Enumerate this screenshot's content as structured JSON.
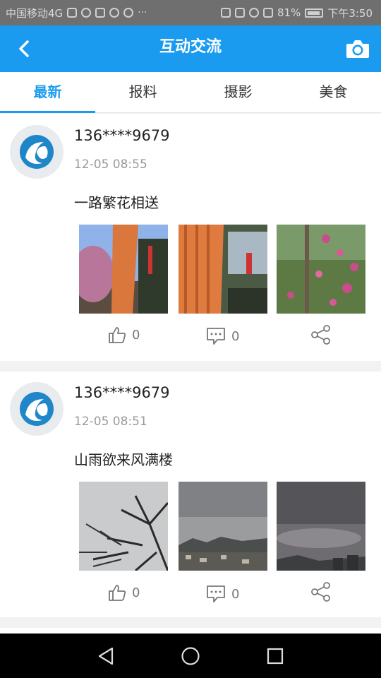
{
  "statusbar": {
    "carrier": "中国移动4G",
    "battery": "81%",
    "time": "下午3:50"
  },
  "header": {
    "title": "互动交流",
    "back_icon": "back-arrow-icon",
    "camera_icon": "camera-icon"
  },
  "tabs": [
    {
      "label": "最新",
      "active": true
    },
    {
      "label": "报料",
      "active": false
    },
    {
      "label": "摄影",
      "active": false
    },
    {
      "label": "美食",
      "active": false
    }
  ],
  "posts": [
    {
      "user": "136****9679",
      "time": "12-05 08:55",
      "text": "一路繁花相送",
      "likes": "0",
      "comments": "0",
      "photos": [
        "flower-bridge-photo",
        "orange-railing-photo",
        "flower-field-photo"
      ]
    },
    {
      "user": "136****9679",
      "time": "12-05 08:51",
      "text": "山雨欲来风满楼",
      "likes": "0",
      "comments": "0",
      "photos": [
        "tree-cloudy-sky-photo",
        "mountain-city-clouds-photo",
        "dark-clouds-photo"
      ]
    }
  ],
  "colors": {
    "accent": "#1a9bf0",
    "statusbar": "#6f6f6f",
    "navbar": "#000000"
  }
}
